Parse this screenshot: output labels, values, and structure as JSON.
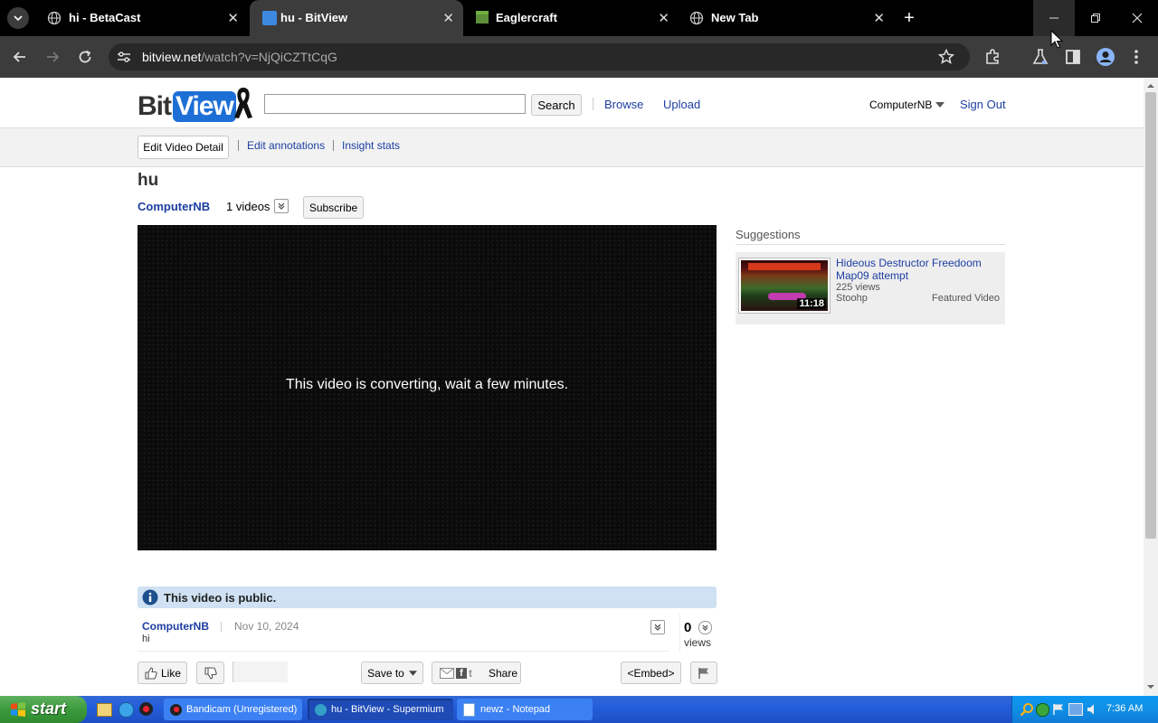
{
  "browser": {
    "tabs": [
      {
        "title": "hi - BetaCast",
        "active": false
      },
      {
        "title": "hu - BitView",
        "active": true
      },
      {
        "title": "Eaglercraft",
        "active": false
      },
      {
        "title": "New Tab",
        "active": false
      }
    ],
    "url_host": "bitview.net",
    "url_path": "/watch?v=NjQiCZTtCqG"
  },
  "site": {
    "logo_text_a": "Bit",
    "logo_text_b": "View",
    "search_placeholder": "",
    "search_label": "Search",
    "nav_browse": "Browse",
    "nav_upload": "Upload",
    "user_name": "ComputerNB",
    "sign_out": "Sign Out"
  },
  "owner_bar": {
    "edit_detail": "Edit Video Detail",
    "edit_annotations": "Edit annotations",
    "insight_stats": "Insight stats"
  },
  "video": {
    "title": "hu",
    "channel": "ComputerNB",
    "video_count": "1 videos",
    "subscribe": "Subscribe",
    "player_message": "This video is converting, wait a few minutes.",
    "public_notice": "This video is public.",
    "date": "Nov 10, 2024",
    "description": "hi",
    "views_count": "0",
    "views_label": "views"
  },
  "actions": {
    "like": "Like",
    "save_to": "Save to",
    "share": "Share",
    "embed": "<Embed>"
  },
  "suggestions": {
    "heading": "Suggestions",
    "items": [
      {
        "title": "Hideous Destructor Freedoom Map09 attempt",
        "views": "225 views",
        "author": "Stoohp",
        "badge": "Featured Video",
        "duration": "11:18"
      }
    ]
  },
  "taskbar": {
    "start": "start",
    "items": [
      {
        "label": "Bandicam (Unregistered)",
        "active": false
      },
      {
        "label": "hu - BitView - Supermium",
        "active": true
      },
      {
        "label": "newz - Notepad",
        "active": false
      }
    ],
    "clock": "7:36 AM"
  },
  "colors": {
    "link": "#1c3ea1",
    "logo_blue": "#1d6fd6",
    "public_bar": "#cfe1f3",
    "taskbar": "#245edb",
    "start_green": "#3c9a3c"
  }
}
